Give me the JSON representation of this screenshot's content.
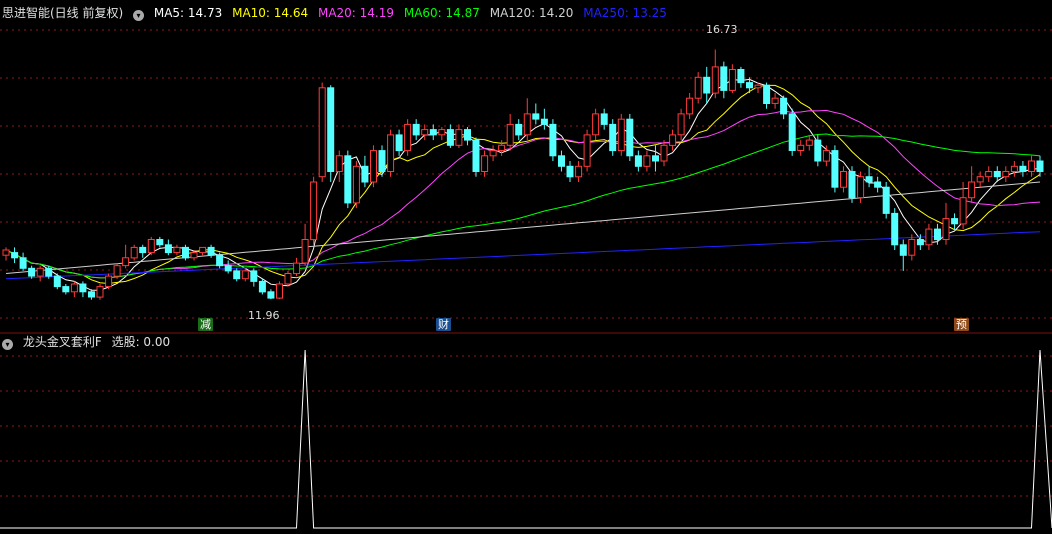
{
  "header": {
    "title": "思进智能(日线 前复权)",
    "ma": [
      {
        "label": "MA5: 14.73",
        "color": "#ffffff"
      },
      {
        "label": "MA10: 14.64",
        "color": "#ffff00"
      },
      {
        "label": "MA20: 14.19",
        "color": "#ff44ff"
      },
      {
        "label": "MA60: 14.87",
        "color": "#00ff00"
      },
      {
        "label": "MA120: 14.20",
        "color": "#cfcfcf"
      },
      {
        "label": "MA250: 13.25",
        "color": "#2222ff"
      }
    ]
  },
  "annotations": {
    "high": "16.73",
    "low": "11.96"
  },
  "markers": [
    {
      "text": "减",
      "color": "#1a6b1a"
    },
    {
      "text": "财",
      "color": "#1a4f8f"
    },
    {
      "text": "预",
      "color": "#8f4a1a"
    }
  ],
  "indicator": {
    "title": "龙头金叉套利F",
    "value_label": "选股: 0.00"
  },
  "colors": {
    "up": "#ff3b3b",
    "down": "#54ffff",
    "grid": "#8a1a1a",
    "background": "#000000"
  },
  "chart_data": {
    "type": "candlestick",
    "price_range": [
      11.6,
      17.2
    ],
    "signal_range": [
      0,
      1
    ],
    "candles": [
      [
        12.8,
        12.9,
        12.7,
        12.95
      ],
      [
        12.85,
        12.75,
        12.65,
        12.95
      ],
      [
        12.75,
        12.55,
        12.5,
        12.85
      ],
      [
        12.55,
        12.4,
        12.35,
        12.6
      ],
      [
        12.4,
        12.55,
        12.3,
        12.6
      ],
      [
        12.55,
        12.4,
        12.35,
        12.6
      ],
      [
        12.4,
        12.2,
        12.15,
        12.45
      ],
      [
        12.2,
        12.1,
        12.05,
        12.25
      ],
      [
        12.1,
        12.25,
        12.0,
        12.3
      ],
      [
        12.25,
        12.1,
        12.0,
        12.3
      ],
      [
        12.1,
        12.0,
        11.95,
        12.15
      ],
      [
        12.0,
        12.2,
        11.95,
        12.25
      ],
      [
        12.2,
        12.4,
        12.15,
        12.45
      ],
      [
        12.4,
        12.6,
        12.35,
        12.65
      ],
      [
        12.6,
        12.75,
        12.55,
        13.0
      ],
      [
        12.75,
        12.95,
        12.7,
        13.0
      ],
      [
        12.95,
        12.85,
        12.75,
        13.0
      ],
      [
        12.85,
        13.1,
        12.8,
        13.15
      ],
      [
        13.1,
        13.0,
        12.95,
        13.15
      ],
      [
        13.0,
        12.85,
        12.8,
        13.1
      ],
      [
        12.85,
        12.95,
        12.8,
        13.0
      ],
      [
        12.95,
        12.75,
        12.7,
        13.0
      ],
      [
        12.75,
        12.85,
        12.7,
        12.9
      ],
      [
        12.85,
        12.95,
        12.8,
        12.95
      ],
      [
        12.95,
        12.8,
        12.75,
        13.0
      ],
      [
        12.8,
        12.6,
        12.55,
        12.85
      ],
      [
        12.6,
        12.5,
        12.45,
        12.7
      ],
      [
        12.5,
        12.35,
        12.3,
        12.55
      ],
      [
        12.35,
        12.5,
        12.3,
        12.55
      ],
      [
        12.5,
        12.3,
        12.2,
        12.55
      ],
      [
        12.3,
        12.1,
        12.05,
        12.35
      ],
      [
        12.1,
        11.98,
        11.96,
        12.15
      ],
      [
        11.98,
        12.25,
        11.96,
        12.3
      ],
      [
        12.25,
        12.45,
        12.2,
        12.5
      ],
      [
        12.45,
        12.65,
        12.4,
        12.75
      ],
      [
        12.65,
        13.1,
        12.6,
        13.4
      ],
      [
        13.1,
        14.2,
        13.0,
        14.3
      ],
      [
        14.3,
        16.0,
        14.2,
        16.1
      ],
      [
        16.0,
        14.4,
        14.2,
        16.05
      ],
      [
        14.4,
        14.7,
        14.2,
        14.8
      ],
      [
        14.7,
        13.8,
        13.7,
        14.8
      ],
      [
        13.8,
        14.5,
        13.7,
        14.6
      ],
      [
        14.5,
        14.2,
        14.1,
        14.7
      ],
      [
        14.2,
        14.8,
        14.1,
        14.9
      ],
      [
        14.8,
        14.4,
        14.3,
        14.9
      ],
      [
        14.4,
        15.1,
        14.3,
        15.2
      ],
      [
        15.1,
        14.8,
        14.7,
        15.2
      ],
      [
        14.8,
        15.3,
        14.7,
        15.4
      ],
      [
        15.3,
        15.1,
        15.0,
        15.4
      ],
      [
        15.1,
        15.2,
        15.0,
        15.3
      ],
      [
        15.2,
        15.1,
        15.0,
        15.3
      ],
      [
        15.1,
        15.2,
        15.0,
        15.25
      ],
      [
        15.2,
        14.9,
        14.85,
        15.3
      ],
      [
        14.9,
        15.2,
        14.85,
        15.3
      ],
      [
        15.2,
        15.0,
        14.9,
        15.25
      ],
      [
        15.0,
        14.4,
        14.3,
        15.05
      ],
      [
        14.4,
        14.7,
        14.3,
        14.8
      ],
      [
        14.7,
        14.8,
        14.6,
        14.9
      ],
      [
        14.8,
        14.9,
        14.7,
        15.0
      ],
      [
        14.9,
        15.3,
        14.8,
        15.5
      ],
      [
        15.3,
        15.1,
        15.0,
        15.4
      ],
      [
        15.1,
        15.5,
        15.0,
        15.8
      ],
      [
        15.5,
        15.4,
        15.3,
        15.7
      ],
      [
        15.4,
        15.3,
        15.2,
        15.6
      ],
      [
        15.3,
        14.7,
        14.6,
        15.4
      ],
      [
        14.7,
        14.5,
        14.4,
        14.8
      ],
      [
        14.5,
        14.3,
        14.2,
        14.6
      ],
      [
        14.3,
        14.5,
        14.2,
        14.6
      ],
      [
        14.5,
        15.1,
        14.4,
        15.2
      ],
      [
        15.1,
        15.5,
        15.0,
        15.6
      ],
      [
        15.5,
        15.3,
        15.2,
        15.6
      ],
      [
        15.3,
        14.8,
        14.7,
        15.4
      ],
      [
        14.8,
        15.4,
        14.7,
        15.5
      ],
      [
        15.4,
        14.7,
        14.6,
        15.5
      ],
      [
        14.7,
        14.5,
        14.4,
        14.8
      ],
      [
        14.5,
        14.7,
        14.4,
        14.8
      ],
      [
        14.7,
        14.6,
        14.4,
        14.9
      ],
      [
        14.6,
        14.9,
        14.5,
        15.0
      ],
      [
        14.9,
        15.1,
        14.8,
        15.2
      ],
      [
        15.1,
        15.5,
        15.0,
        15.6
      ],
      [
        15.5,
        15.8,
        15.4,
        15.9
      ],
      [
        15.8,
        16.2,
        15.7,
        16.3
      ],
      [
        16.2,
        15.9,
        15.7,
        16.4
      ],
      [
        15.9,
        16.4,
        15.8,
        16.73
      ],
      [
        16.4,
        15.95,
        15.8,
        16.5
      ],
      [
        15.95,
        16.35,
        15.9,
        16.45
      ],
      [
        16.35,
        16.1,
        16.0,
        16.4
      ],
      [
        16.1,
        16.0,
        15.9,
        16.2
      ],
      [
        16.0,
        16.05,
        15.9,
        16.1
      ],
      [
        16.05,
        15.7,
        15.6,
        16.1
      ],
      [
        15.7,
        15.8,
        15.6,
        15.9
      ],
      [
        15.8,
        15.5,
        15.4,
        15.85
      ],
      [
        15.5,
        14.8,
        14.7,
        15.6
      ],
      [
        14.8,
        14.9,
        14.7,
        15.0
      ],
      [
        14.9,
        15.0,
        14.8,
        15.1
      ],
      [
        15.0,
        14.6,
        14.5,
        15.1
      ],
      [
        14.6,
        14.8,
        14.5,
        14.9
      ],
      [
        14.8,
        14.1,
        14.0,
        14.9
      ],
      [
        14.1,
        14.4,
        14.0,
        14.5
      ],
      [
        14.4,
        13.9,
        13.8,
        14.5
      ],
      [
        13.9,
        14.3,
        13.8,
        14.4
      ],
      [
        14.3,
        14.2,
        14.1,
        14.5
      ],
      [
        14.2,
        14.1,
        14.0,
        14.3
      ],
      [
        14.1,
        13.6,
        13.5,
        14.2
      ],
      [
        13.6,
        13.0,
        12.9,
        13.7
      ],
      [
        13.0,
        12.8,
        12.5,
        13.1
      ],
      [
        12.8,
        13.1,
        12.7,
        13.2
      ],
      [
        13.1,
        13.0,
        12.9,
        13.2
      ],
      [
        13.0,
        13.3,
        12.9,
        13.4
      ],
      [
        13.3,
        13.1,
        13.0,
        13.4
      ],
      [
        13.1,
        13.5,
        13.0,
        13.8
      ],
      [
        13.5,
        13.4,
        13.3,
        13.6
      ],
      [
        13.4,
        13.9,
        13.3,
        14.2
      ],
      [
        13.9,
        14.2,
        13.8,
        14.5
      ],
      [
        14.2,
        14.3,
        14.1,
        14.4
      ],
      [
        14.3,
        14.4,
        14.2,
        14.5
      ],
      [
        14.4,
        14.3,
        14.2,
        14.5
      ],
      [
        14.3,
        14.4,
        14.2,
        14.5
      ],
      [
        14.4,
        14.5,
        14.3,
        14.6
      ],
      [
        14.5,
        14.4,
        14.3,
        14.6
      ],
      [
        14.4,
        14.6,
        14.3,
        14.7
      ],
      [
        14.6,
        14.4,
        14.3,
        14.7
      ]
    ],
    "ma_lines": [
      {
        "name": "MA5",
        "color": "#ffffff"
      },
      {
        "name": "MA10",
        "color": "#ffff00"
      },
      {
        "name": "MA20",
        "color": "#ff44ff"
      },
      {
        "name": "MA60",
        "color": "#00ff00"
      },
      {
        "name": "MA120",
        "color": "#cfcfcf"
      },
      {
        "name": "MA250",
        "color": "#2222ff"
      }
    ],
    "signals": [
      35,
      121
    ]
  }
}
